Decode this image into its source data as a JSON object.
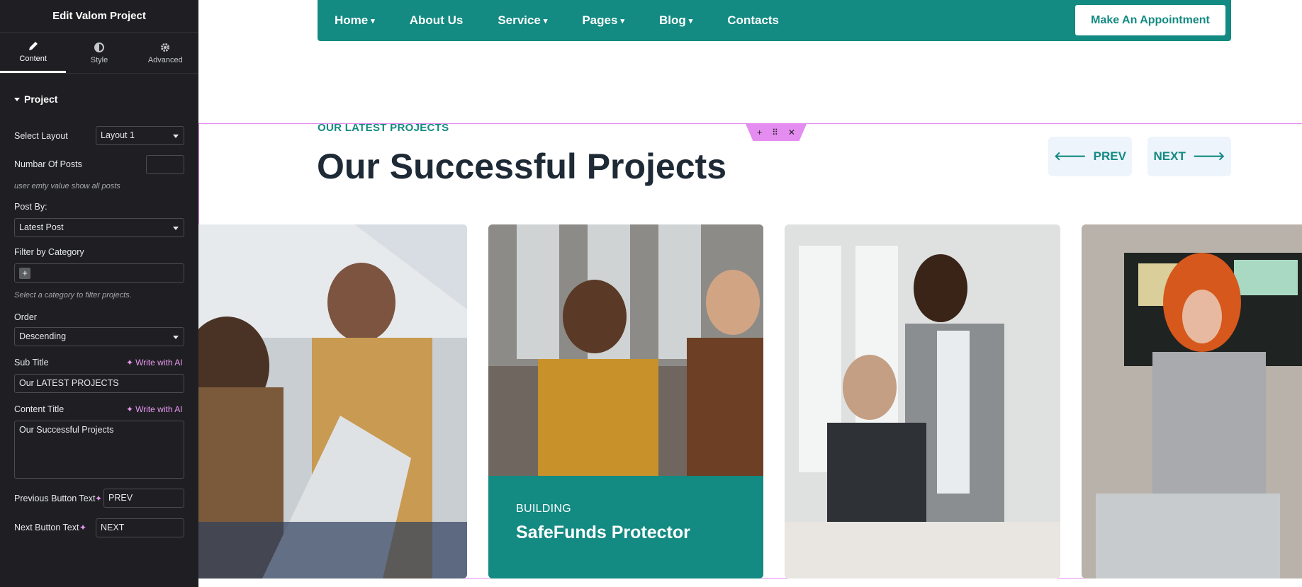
{
  "panel": {
    "title": "Edit Valom Project",
    "tabs": [
      {
        "label": "Content",
        "icon": "pencil-icon"
      },
      {
        "label": "Style",
        "icon": "contrast-icon"
      },
      {
        "label": "Advanced",
        "icon": "gear-icon"
      }
    ],
    "section": "Project",
    "select_layout_label": "Select Layout",
    "select_layout_value": "Layout 1",
    "posts_label": "Numbar Of Posts",
    "posts_value": "",
    "posts_hint": "user emty value show all posts",
    "post_by_label": "Post By:",
    "post_by_value": "Latest Post",
    "filter_label": "Filter by Category",
    "filter_hint": "Select a category to filter projects.",
    "order_label": "Order",
    "order_value": "Descending",
    "subtitle_label": "Sub Title",
    "write_ai": "Write with AI",
    "subtitle_value": "Our LATEST PROJECTS",
    "content_title_label": "Content Title",
    "content_title_value": "Our Successful Projects",
    "prev_label": "Previous Button Text",
    "prev_value": "PREV",
    "next_label": "Next Button Text",
    "next_value": "NEXT"
  },
  "nav": {
    "items": [
      "Home",
      "About Us",
      "Service",
      "Pages",
      "Blog",
      "Contacts"
    ],
    "cta": "Make An Appointment"
  },
  "section": {
    "subtitle": "OUR LATEST PROJECTS",
    "title": "Our Successful Projects",
    "prev": "PREV",
    "next": "NEXT"
  },
  "cards": [
    {
      "category": "",
      "title": ""
    },
    {
      "category": "BUILDING",
      "title": "SafeFunds Protector"
    },
    {
      "category": "",
      "title": ""
    },
    {
      "category": "",
      "title": ""
    }
  ],
  "colors": {
    "brand": "#138a82",
    "editor_accent": "#e58cf0",
    "panel_bg": "#1f1f23"
  }
}
